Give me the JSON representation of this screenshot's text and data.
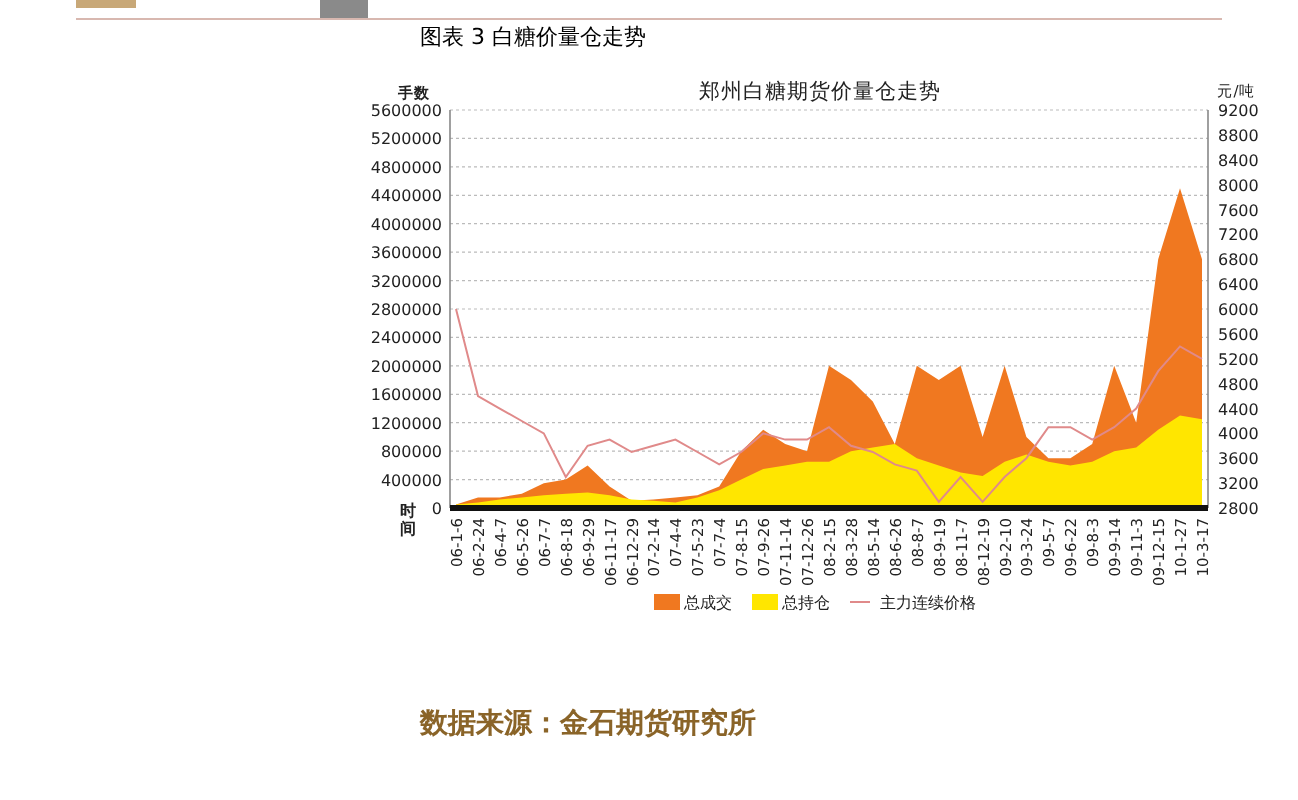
{
  "caption": "图表 3 白糖价量仓走势",
  "chart": {
    "chart_data": {
      "type": "area",
      "title": "郑州白糖期货价量仓走势",
      "xlabel": "时间",
      "ylabel": "手数",
      "y2label": "元/吨",
      "categories": [
        "06-1-6",
        "06-2-24",
        "06-4-7",
        "06-5-26",
        "06-7-7",
        "06-8-18",
        "06-9-29",
        "06-11-17",
        "06-12-29",
        "07-2-14",
        "07-4-4",
        "07-5-23",
        "07-7-4",
        "07-8-15",
        "07-9-26",
        "07-11-14",
        "07-12-26",
        "08-2-15",
        "08-3-28",
        "08-5-14",
        "08-6-26",
        "08-8-7",
        "08-9-19",
        "08-11-7",
        "08-12-19",
        "09-2-10",
        "09-3-24",
        "09-5-7",
        "09-6-22",
        "09-8-3",
        "09-9-14",
        "09-11-3",
        "09-12-15",
        "10-1-27",
        "10-3-17"
      ],
      "series": [
        {
          "name": "总成交",
          "color": "#f07820",
          "values": [
            50000,
            150000,
            150000,
            200000,
            350000,
            400000,
            600000,
            300000,
            100000,
            120000,
            150000,
            180000,
            300000,
            800000,
            1100000,
            900000,
            800000,
            2000000,
            1800000,
            1500000,
            900000,
            2000000,
            1800000,
            2000000,
            1000000,
            2000000,
            1000000,
            700000,
            700000,
            900000,
            2000000,
            1200000,
            3500000,
            4500000,
            3500000
          ]
        },
        {
          "name": "总持仓",
          "color": "#ffe600",
          "values": [
            50000,
            80000,
            120000,
            150000,
            180000,
            200000,
            220000,
            180000,
            120000,
            100000,
            80000,
            150000,
            250000,
            400000,
            550000,
            600000,
            650000,
            650000,
            800000,
            850000,
            900000,
            700000,
            600000,
            500000,
            450000,
            650000,
            750000,
            650000,
            600000,
            650000,
            800000,
            850000,
            1100000,
            1300000,
            1250000
          ]
        },
        {
          "name": "主力连续价格",
          "color": "#e08a8a",
          "axis": "y2",
          "type": "line",
          "values": [
            6000,
            4600,
            4400,
            4200,
            4000,
            3300,
            3800,
            3900,
            3700,
            3800,
            3900,
            3700,
            3500,
            3700,
            4000,
            3900,
            3900,
            4100,
            3800,
            3700,
            3500,
            3400,
            2900,
            3300,
            2900,
            3300,
            3600,
            4100,
            4100,
            3900,
            4100,
            4400,
            5000,
            5400,
            5200
          ]
        }
      ],
      "grid": true,
      "legend": true,
      "ylim": [
        0,
        5600000
      ],
      "yticks": [
        0,
        400000,
        800000,
        1200000,
        1600000,
        2000000,
        2400000,
        2800000,
        3200000,
        3600000,
        4000000,
        4400000,
        4800000,
        5200000,
        5600000
      ],
      "y2lim": [
        2800,
        9200
      ],
      "y2ticks": [
        2800,
        3200,
        3600,
        4000,
        4400,
        4800,
        5200,
        5600,
        6000,
        6400,
        6800,
        7200,
        7600,
        8000,
        8400,
        8800,
        9200
      ]
    }
  },
  "source": "数据来源：金石期货研究所"
}
